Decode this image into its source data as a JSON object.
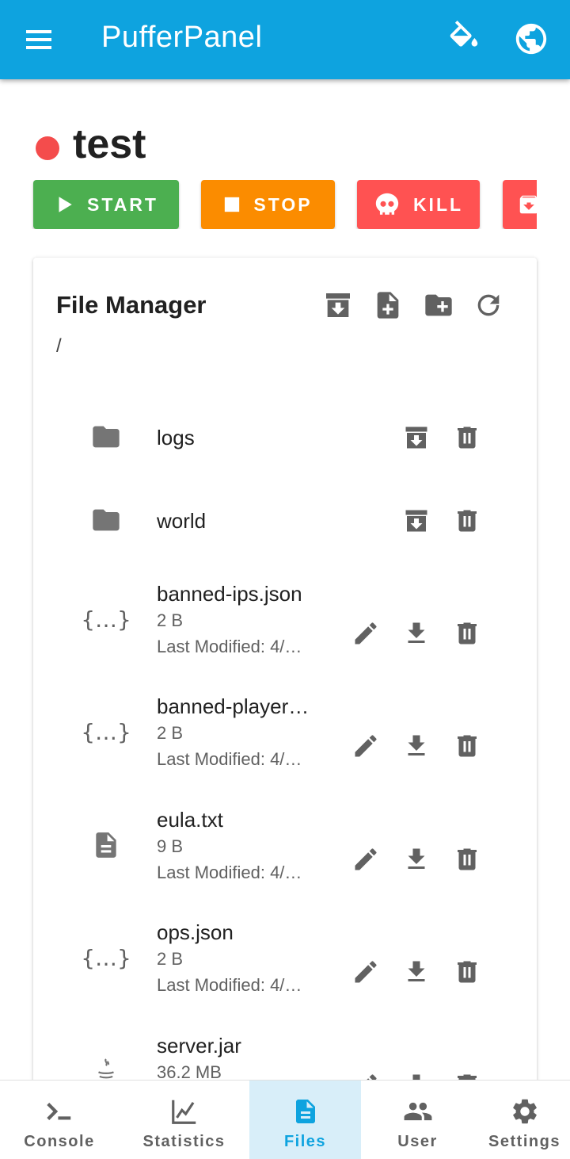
{
  "appbar": {
    "title": "PufferPanel",
    "menu_icon": "menu-icon",
    "theme_icon": "format-color-fill-icon",
    "language_icon": "globe-icon",
    "color": "#0ea3df"
  },
  "server": {
    "name": "test",
    "status_color": "#f44c4c"
  },
  "actions": {
    "start_label": "START",
    "stop_label": "STOP",
    "kill_label": "KILL",
    "start_color": "#4caf50",
    "stop_color": "#fb8c00",
    "kill_color": "#ff5252"
  },
  "file_manager": {
    "title": "File Manager",
    "path": "/",
    "files": [
      {
        "name": "logs",
        "type": "folder"
      },
      {
        "name": "world",
        "type": "folder"
      },
      {
        "name": "banned-ips.json",
        "type": "json",
        "size": "2 B",
        "modified": "Last Modified: 4/…"
      },
      {
        "name": "banned-player…",
        "type": "json",
        "size": "2 B",
        "modified": "Last Modified: 4/…"
      },
      {
        "name": "eula.txt",
        "type": "text",
        "size": "9 B",
        "modified": "Last Modified: 4/…"
      },
      {
        "name": "ops.json",
        "type": "json",
        "size": "2 B",
        "modified": "Last Modified: 4/…"
      },
      {
        "name": "server.jar",
        "type": "java",
        "size": "36.2 MB"
      }
    ]
  },
  "bottom_nav": {
    "items": [
      {
        "label": "Console",
        "icon": "console-icon"
      },
      {
        "label": "Statistics",
        "icon": "chart-icon"
      },
      {
        "label": "Files",
        "icon": "file-icon",
        "active": true
      },
      {
        "label": "User",
        "icon": "users-icon"
      },
      {
        "label": "Settings",
        "icon": "gear-icon"
      }
    ]
  }
}
